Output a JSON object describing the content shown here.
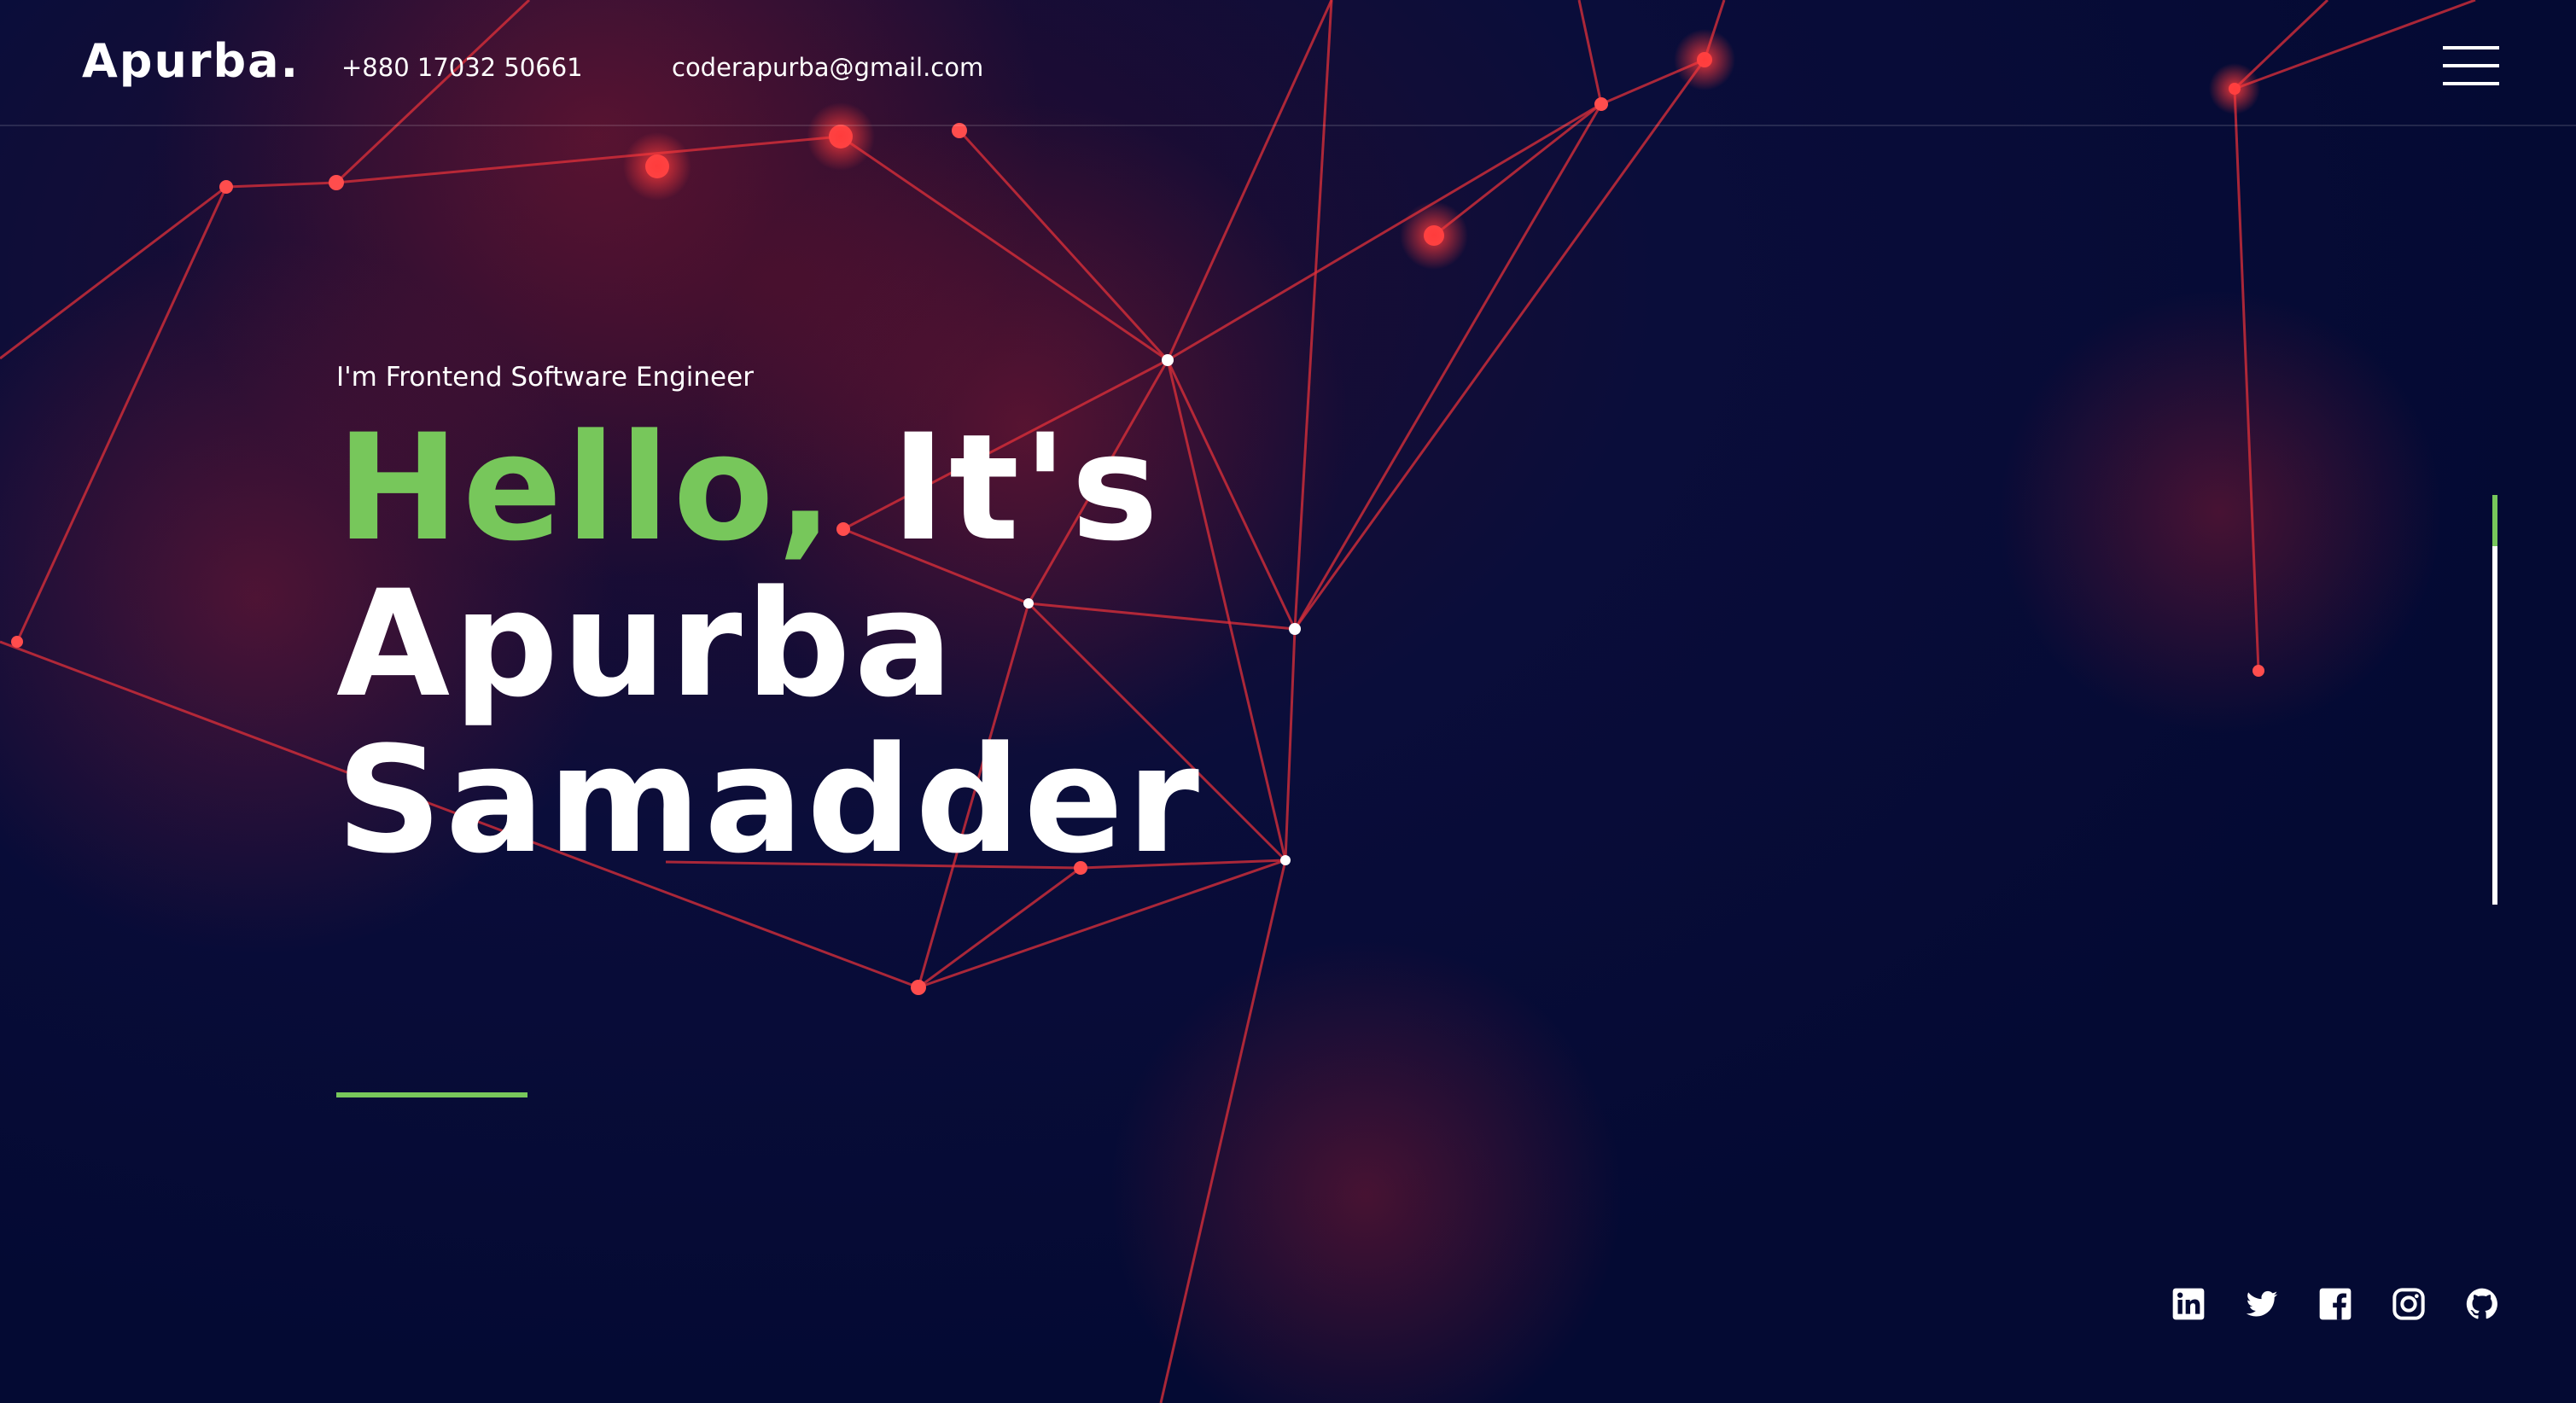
{
  "header": {
    "brand": "Apurba.",
    "phone": "+880 17032 50661",
    "email": "coderapurba@gmail.com"
  },
  "hero": {
    "subtitle": "I'm Frontend Software Engineer",
    "greeting": "Hello,",
    "greeting_rest": "It's",
    "first_name": "Apurba",
    "last_name": "Samadder"
  },
  "social": [
    "linkedin-icon",
    "twitter-icon",
    "facebook-icon",
    "instagram-icon",
    "github-icon"
  ],
  "colors": {
    "background": "#050a33",
    "accent": "#77c75b",
    "network": "#e0303a",
    "text": "#ffffff"
  }
}
